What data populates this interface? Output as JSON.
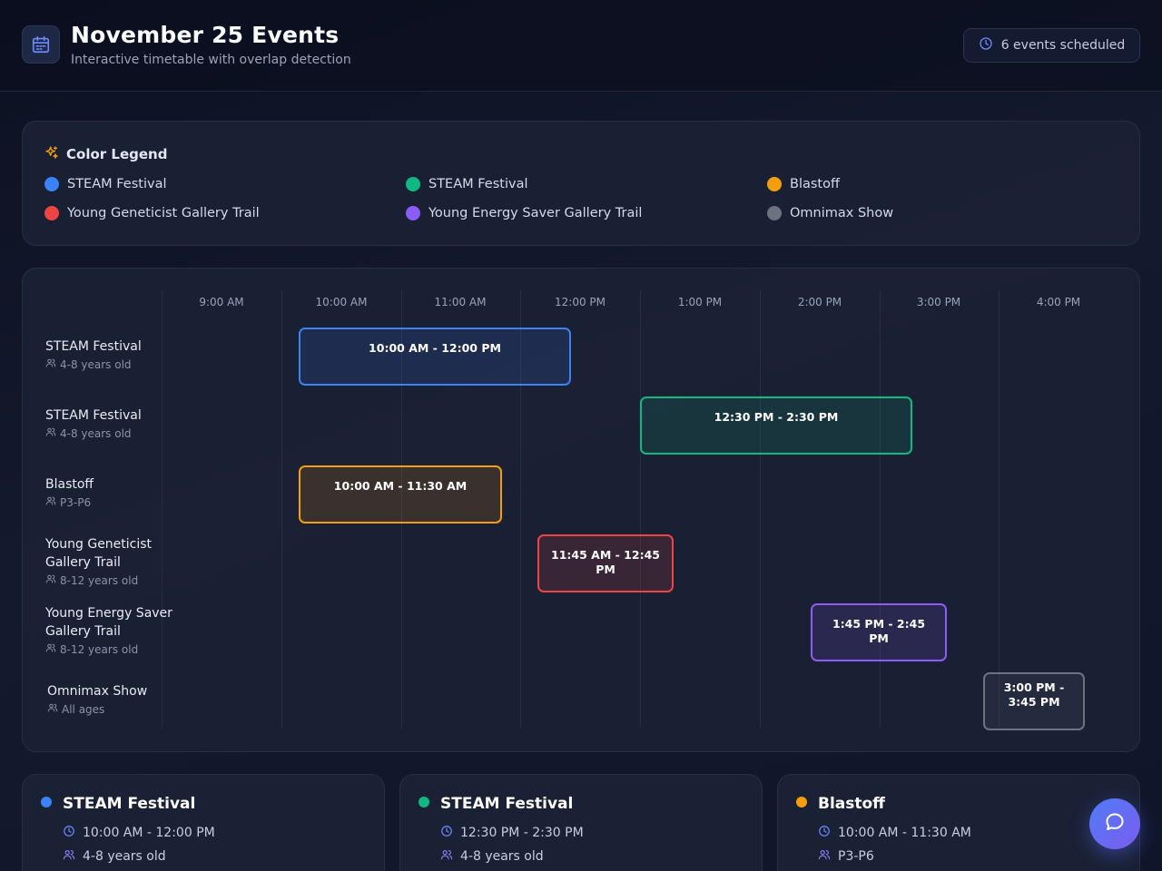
{
  "header": {
    "title": "November 25 Events",
    "subtitle": "Interactive timetable with overlap detection",
    "badge": "6 events scheduled"
  },
  "legend": {
    "title": "Color Legend",
    "items": [
      {
        "label": "STEAM Festival",
        "color": "#3b82f6"
      },
      {
        "label": "STEAM Festival",
        "color": "#10b981"
      },
      {
        "label": "Blastoff",
        "color": "#f59e0b"
      },
      {
        "label": "Young Geneticist Gallery Trail",
        "color": "#ef4444"
      },
      {
        "label": "Young Energy Saver Gallery Trail",
        "color": "#8b5cf6"
      },
      {
        "label": "Omnimax Show",
        "color": "#6b7280"
      }
    ]
  },
  "timeline": {
    "time_labels": [
      "9:00 AM",
      "10:00 AM",
      "11:00 AM",
      "12:00 PM",
      "1:00 PM",
      "2:00 PM",
      "3:00 PM",
      "4:00 PM"
    ],
    "rows": [
      {
        "name": "STEAM Festival",
        "age": "4-8 years old",
        "time_lines": [
          "10:00 AM - 12:00 PM"
        ],
        "color": "#3b82f6"
      },
      {
        "name": "STEAM Festival",
        "age": "4-8 years old",
        "time_lines": [
          "12:30 PM - 2:30 PM"
        ],
        "color": "#10b981"
      },
      {
        "name": "Blastoff",
        "age": "P3-P6",
        "time_lines": [
          "10:00 AM - 11:30 AM"
        ],
        "color": "#f59e0b"
      },
      {
        "name": "Young Geneticist Gallery Trail",
        "age": "8-12 years old",
        "time_lines": [
          "11:45 AM - 12:45",
          "PM"
        ],
        "color": "#ef4444"
      },
      {
        "name": "Young Energy Saver Gallery Trail",
        "age": "8-12 years old",
        "time_lines": [
          "1:45 PM - 2:45",
          "PM"
        ],
        "color": "#8b5cf6"
      },
      {
        "name": "Omnimax Show",
        "age": "All ages",
        "time_lines": [
          "3:00 PM -",
          "3:45 PM"
        ],
        "color": "#6b7280"
      }
    ]
  },
  "details": [
    {
      "title": "STEAM Festival",
      "time": "10:00 AM - 12:00 PM",
      "age": "4-8 years old",
      "color": "#3b82f6"
    },
    {
      "title": "STEAM Festival",
      "time": "12:30 PM - 2:30 PM",
      "age": "4-8 years old",
      "color": "#10b981"
    },
    {
      "title": "Blastoff",
      "time": "10:00 AM - 11:30 AM",
      "age": "P3-P6",
      "color": "#f59e0b"
    }
  ],
  "colors": {
    "accent": "#6b8cff",
    "icon_orange": "#f59e0b"
  }
}
